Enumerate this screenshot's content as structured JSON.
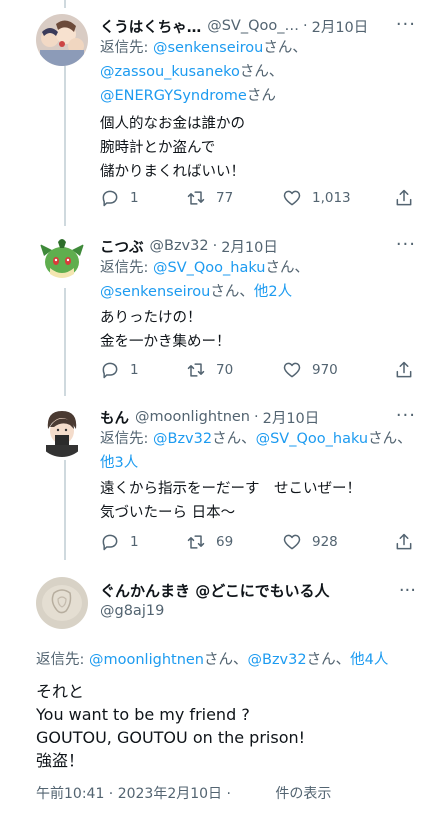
{
  "replies": [
    {
      "name": "くうはくちゃ…",
      "handle": "@SV_Qoo_…",
      "date": "2月10日",
      "reply_prefix": "返信先: ",
      "mentions": [
        "@senkenseirou",
        "@zassou_kusaneko",
        "@ENERGYSyndrome"
      ],
      "suffix": "さん",
      "text_lines": [
        "個人的なお金は誰かの",
        "腕時計とか盗んで",
        "儲かりまくればいい！"
      ],
      "counts": {
        "reply": "1",
        "retweet": "77",
        "like": "1,013"
      }
    },
    {
      "name": "こつぶ",
      "handle": "@Bzv32",
      "date": "2月10日",
      "reply_prefix": "返信先: ",
      "mentions": [
        "@SV_Qoo_haku",
        "@senkenseirou"
      ],
      "others": "他2人",
      "suffix": "さん",
      "text_lines": [
        "ありったけの！",
        "金を一かき集めー！"
      ],
      "counts": {
        "reply": "1",
        "retweet": "70",
        "like": "970"
      }
    },
    {
      "name": "もん",
      "handle": "@moonlightnen",
      "date": "2月10日",
      "reply_prefix": "返信先: ",
      "mentions": [
        "@Bzv32",
        "@SV_Qoo_haku"
      ],
      "others": "他3人",
      "suffix": "さん",
      "text_lines": [
        "遠くから指示をーだーす　せこいぜー！",
        "気づいたーら 日本〜"
      ],
      "counts": {
        "reply": "1",
        "retweet": "69",
        "like": "928"
      }
    }
  ],
  "main": {
    "name": "ぐんかんまき @どこにでもいる人",
    "handle": "@g8aj19",
    "reply_prefix": "返信先: ",
    "mentions": [
      "@moonlightnen",
      "@Bzv32"
    ],
    "others": "他4人",
    "suffix": "さん",
    "text_lines": [
      "それと",
      "You want to be my friend ?",
      "GOUTOU, GOUTOU on the prison!",
      "強盗！"
    ],
    "timestamp": "午前10:41 · 2023年2月10日 ·",
    "views_label": "件の表示"
  },
  "ui": {
    "more": "···",
    "sep": "·",
    "comma": "、"
  },
  "colors": {
    "link": "#1d9bf0",
    "secondary": "#536471",
    "text": "#0f1419"
  }
}
